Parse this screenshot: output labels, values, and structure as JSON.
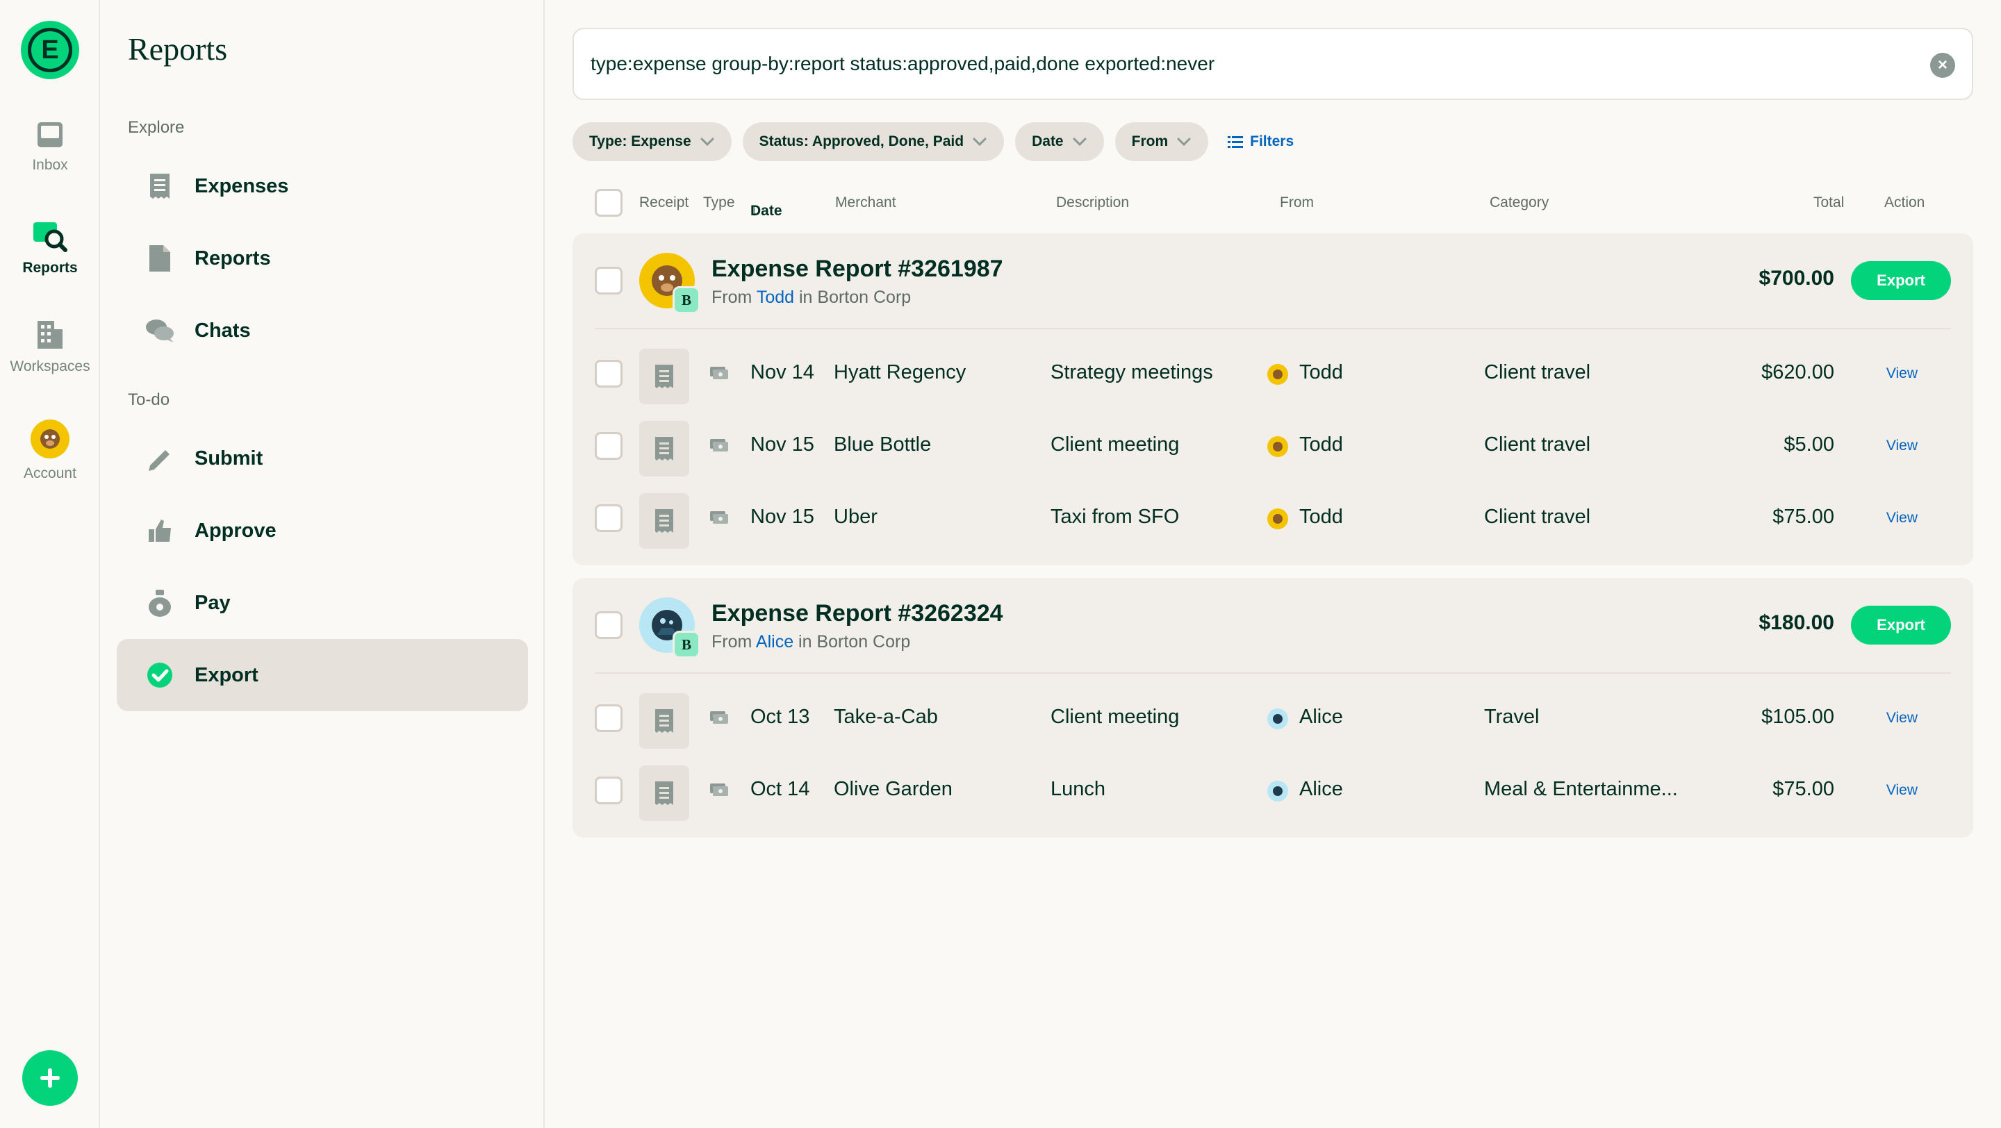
{
  "rail": {
    "items": [
      {
        "label": "Inbox",
        "icon": "inbox-icon"
      },
      {
        "label": "Reports",
        "icon": "reports-search-icon",
        "active": true
      },
      {
        "label": "Workspaces",
        "icon": "building-icon"
      },
      {
        "label": "Account",
        "icon": "user-avatar"
      }
    ]
  },
  "sidebar": {
    "title": "Reports",
    "explore_label": "Explore",
    "todo_label": "To-do",
    "explore": [
      {
        "label": "Expenses",
        "icon": "receipt-icon"
      },
      {
        "label": "Reports",
        "icon": "document-icon"
      },
      {
        "label": "Chats",
        "icon": "chat-bubbles-icon"
      }
    ],
    "todo": [
      {
        "label": "Submit",
        "icon": "pencil-icon"
      },
      {
        "label": "Approve",
        "icon": "thumbs-up-icon"
      },
      {
        "label": "Pay",
        "icon": "money-bag-icon"
      },
      {
        "label": "Export",
        "icon": "check-circle-icon",
        "active": true
      }
    ]
  },
  "search": {
    "query": "type:expense group-by:report status:approved,paid,done exported:never"
  },
  "filters": {
    "chips": [
      "Type: Expense",
      "Status: Approved, Done, Paid",
      "Date",
      "From"
    ],
    "filters_label": "Filters"
  },
  "columns": {
    "receipt": "Receipt",
    "type": "Type",
    "date": "Date",
    "merchant": "Merchant",
    "description": "Description",
    "from": "From",
    "category": "Category",
    "total": "Total",
    "action": "Action"
  },
  "reports": [
    {
      "title": "Expense Report #3261987",
      "from_prefix": "From",
      "from_name": "Todd",
      "in_text": "in Borton Corp",
      "workspace_badge": "B",
      "total": "$700.00",
      "export_label": "Export",
      "rows": [
        {
          "date": "Nov 14",
          "merchant": "Hyatt Regency",
          "description": "Strategy meetings",
          "from": "Todd",
          "category": "Client travel",
          "amount": "$620.00",
          "action": "View"
        },
        {
          "date": "Nov 15",
          "merchant": "Blue Bottle",
          "description": "Client meeting",
          "from": "Todd",
          "category": "Client travel",
          "amount": "$5.00",
          "action": "View"
        },
        {
          "date": "Nov 15",
          "merchant": "Uber",
          "description": "Taxi from SFO",
          "from": "Todd",
          "category": "Client travel",
          "amount": "$75.00",
          "action": "View"
        }
      ]
    },
    {
      "title": "Expense Report #3262324",
      "from_prefix": "From",
      "from_name": "Alice",
      "in_text": "in Borton Corp",
      "workspace_badge": "B",
      "total": "$180.00",
      "export_label": "Export",
      "rows": [
        {
          "date": "Oct 13",
          "merchant": "Take-a-Cab",
          "description": "Client meeting",
          "from": "Alice",
          "category": "Travel",
          "amount": "$105.00",
          "action": "View"
        },
        {
          "date": "Oct 14",
          "merchant": "Olive Garden",
          "description": "Lunch",
          "from": "Alice",
          "category": "Meal & Entertainme...",
          "amount": "$75.00",
          "action": "View"
        }
      ]
    }
  ],
  "colors": {
    "brand_green": "#03d47c",
    "dark_text": "#002e22",
    "link_blue": "#0164bf",
    "active_bg": "#e6e1da"
  }
}
